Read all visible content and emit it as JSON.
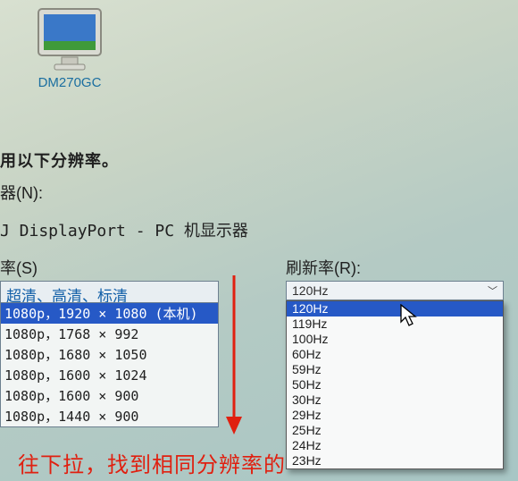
{
  "monitor": {
    "label": "DM270GC"
  },
  "heading": "用以下分辨率。",
  "device": {
    "label": "器(N):",
    "value": "J  DisplayPort - PC 机显示器"
  },
  "rate_label": "率(S)",
  "refresh_label": "刷新率(R):",
  "res_group": "超清、高清、标清",
  "resolutions": [
    {
      "text": "1080p，1920 × 1080 (本机)",
      "selected": true
    },
    {
      "text": "1080p，1768 × 992",
      "selected": false
    },
    {
      "text": "1080p，1680 × 1050",
      "selected": false
    },
    {
      "text": "1080p，1600 × 1024",
      "selected": false
    },
    {
      "text": "1080p，1600 × 900",
      "selected": false
    },
    {
      "text": "1080p，1440 × 900",
      "selected": false
    }
  ],
  "refresh_selected": "120Hz",
  "refresh_options": [
    {
      "text": "120Hz",
      "selected": true
    },
    {
      "text": "119Hz",
      "selected": false
    },
    {
      "text": "100Hz",
      "selected": false
    },
    {
      "text": "60Hz",
      "selected": false
    },
    {
      "text": "59Hz",
      "selected": false
    },
    {
      "text": "50Hz",
      "selected": false
    },
    {
      "text": "30Hz",
      "selected": false
    },
    {
      "text": "29Hz",
      "selected": false
    },
    {
      "text": "25Hz",
      "selected": false
    },
    {
      "text": "24Hz",
      "selected": false
    },
    {
      "text": "23Hz",
      "selected": false
    }
  ],
  "instruction": "往下拉，找到相同分辨率的",
  "colors": {
    "highlight": "#2659c6",
    "link": "#1360a8",
    "red": "#e02010"
  }
}
